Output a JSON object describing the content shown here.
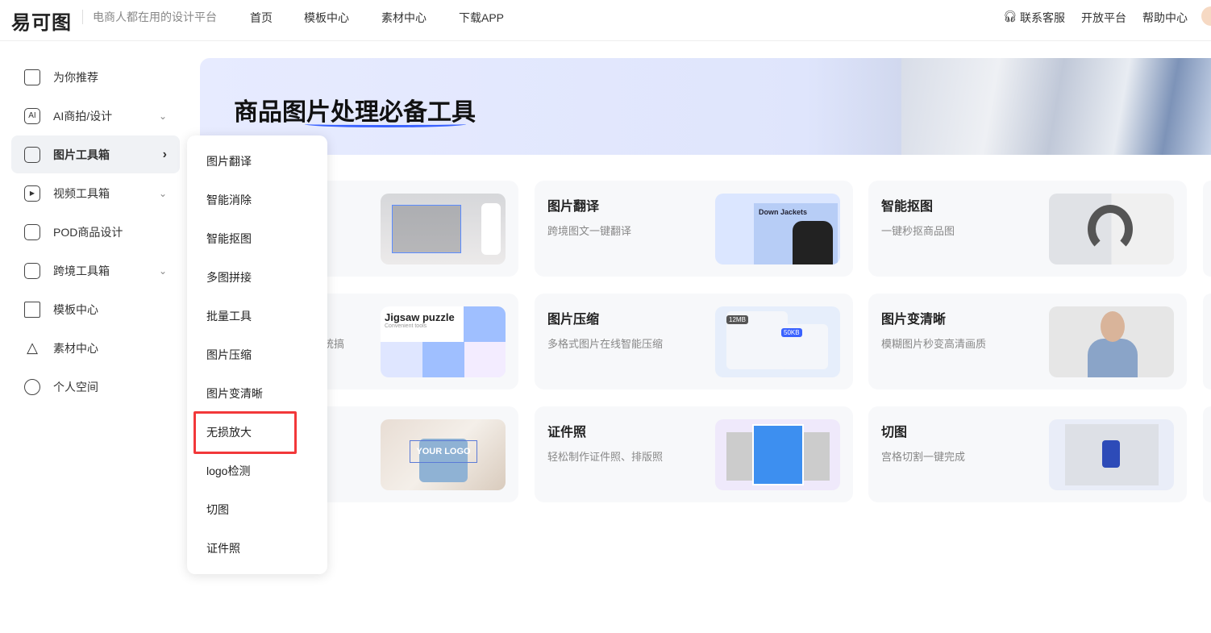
{
  "header": {
    "logo": "易可图",
    "slogan": "电商人都在用的设计平台",
    "nav": [
      "首页",
      "模板中心",
      "素材中心",
      "下载APP"
    ],
    "right": [
      "联系客服",
      "开放平台",
      "帮助中心"
    ]
  },
  "sidebar": {
    "items": [
      {
        "label": "为你推荐",
        "icon": "home-icon"
      },
      {
        "label": "AI商拍/设计",
        "icon": "ai-icon",
        "chevron": "⌄"
      },
      {
        "label": "图片工具箱",
        "icon": "toolbox-icon",
        "chevron": "›",
        "active": true
      },
      {
        "label": "视频工具箱",
        "icon": "video-icon",
        "chevron": "⌄"
      },
      {
        "label": "POD商品设计",
        "icon": "bag-icon"
      },
      {
        "label": "跨境工具箱",
        "icon": "bookmark-icon",
        "chevron": "⌄"
      },
      {
        "label": "模板中心",
        "icon": "template-icon"
      },
      {
        "label": "素材中心",
        "icon": "shapes-icon"
      },
      {
        "label": "个人空间",
        "icon": "user-icon"
      }
    ]
  },
  "banner": {
    "title": "商品图片处理必备工具"
  },
  "cards": [
    {
      "title": "",
      "desc": ""
    },
    {
      "title": "图片翻译",
      "desc": "跨境图文一键翻译",
      "thumb": "Down Jackets"
    },
    {
      "title": "智能抠图",
      "desc": "一键秒抠商品图"
    },
    {
      "title": "",
      "desc": "统统搞",
      "thumb": "Jigsaw puzzle",
      "thumb_sub": "Convenient tools"
    },
    {
      "title": "图片压缩",
      "desc": "多格式图片在线智能压缩",
      "thumb": "12MB",
      "thumb2": "50KB"
    },
    {
      "title": "图片变清晰",
      "desc": "模糊图片秒变高清画质"
    },
    {
      "title": "",
      "desc": "",
      "thumb": "YOUR LOGO"
    },
    {
      "title": "证件照",
      "desc": "轻松制作证件照、排版照"
    },
    {
      "title": "切图",
      "desc": "宫格切割一键完成"
    }
  ],
  "menu": {
    "items": [
      "图片翻译",
      "智能消除",
      "智能抠图",
      "多图拼接",
      "批量工具",
      "图片压缩",
      "图片变清晰",
      "无损放大",
      "logo检测",
      "切图",
      "证件照"
    ],
    "highlighted": "无损放大"
  },
  "colors": {
    "accent": "#3a62ff",
    "highlight": "#f2383a"
  }
}
